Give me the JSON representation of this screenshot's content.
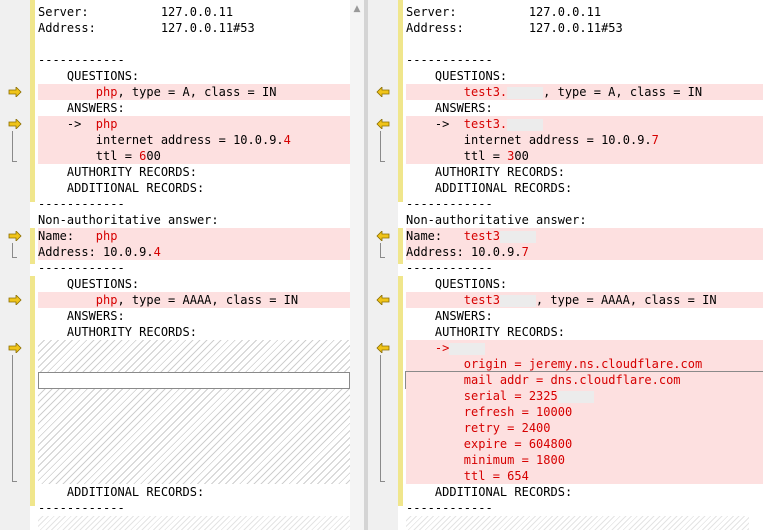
{
  "left": {
    "lines": [
      {
        "t": "Server:          127.0.0.11"
      },
      {
        "t": "Address:         127.0.0.11#53"
      },
      {
        "t": ""
      },
      {
        "t": "------------"
      },
      {
        "t": "    QUESTIONS:"
      },
      {
        "t": "",
        "diff": true,
        "pre": "        ",
        "red": "php",
        "post": ", type = A, class = IN"
      },
      {
        "t": "    ANSWERS:"
      },
      {
        "t": "",
        "diff": true,
        "pre": "    ->  ",
        "red": "php",
        "post": ""
      },
      {
        "t": "",
        "diff": true,
        "pre": "        internet address = 10.0.9.",
        "red": "4",
        "post": ""
      },
      {
        "t": "",
        "diff": true,
        "pre": "        ttl = ",
        "red": "6",
        "post": "00"
      },
      {
        "t": "    AUTHORITY RECORDS:"
      },
      {
        "t": "    ADDITIONAL RECORDS:"
      },
      {
        "t": "------------"
      },
      {
        "t": "Non-authoritative answer:"
      },
      {
        "t": "",
        "diff": true,
        "pre": "Name:   ",
        "red": "php",
        "post": ""
      },
      {
        "t": "",
        "diff": true,
        "pre": "Address: 10.0.9.",
        "red": "4",
        "post": ""
      },
      {
        "t": "------------"
      },
      {
        "t": "    QUESTIONS:"
      },
      {
        "t": "",
        "diff": true,
        "pre": "        ",
        "red": "php",
        "post": ", type = AAAA, class = IN"
      },
      {
        "t": "    ANSWERS:"
      },
      {
        "t": "    AUTHORITY RECORDS:"
      }
    ],
    "tail": [
      {
        "t": "    ADDITIONAL RECORDS:"
      },
      {
        "t": "------------"
      }
    ]
  },
  "right": {
    "lines": [
      {
        "t": "Server:          127.0.0.11"
      },
      {
        "t": "Address:         127.0.0.11#53"
      },
      {
        "t": ""
      },
      {
        "t": "------------"
      },
      {
        "t": "    QUESTIONS:"
      },
      {
        "t": "",
        "diff": true,
        "pre": "        ",
        "red": "test3.",
        "redact": true,
        "post": ", type = A, class = IN"
      },
      {
        "t": "    ANSWERS:"
      },
      {
        "t": "",
        "diff": true,
        "pre": "    ->  ",
        "red": "test3.",
        "redact": true,
        "post": ""
      },
      {
        "t": "",
        "diff": true,
        "pre": "        internet address = 10.0.9.",
        "red": "7",
        "post": ""
      },
      {
        "t": "",
        "diff": true,
        "pre": "        ttl = ",
        "red": "3",
        "post": "00"
      },
      {
        "t": "    AUTHORITY RECORDS:"
      },
      {
        "t": "    ADDITIONAL RECORDS:"
      },
      {
        "t": "------------"
      },
      {
        "t": "Non-authoritative answer:"
      },
      {
        "t": "",
        "diff": true,
        "pre": "Name:   ",
        "red": "test3",
        "redact": true,
        "post": ""
      },
      {
        "t": "",
        "diff": true,
        "pre": "Address: 10.0.9.",
        "red": "7",
        "post": ""
      },
      {
        "t": "------------"
      },
      {
        "t": "    QUESTIONS:"
      },
      {
        "t": "",
        "diff": true,
        "pre": "        ",
        "red": "test3",
        "redact": true,
        "post": ", type = AAAA, class = IN"
      },
      {
        "t": "    ANSWERS:"
      },
      {
        "t": "    AUTHORITY RECORDS:"
      },
      {
        "t": "",
        "diff": true,
        "pre": "    ",
        "red": "->",
        "redact": true,
        "post": ""
      },
      {
        "t": "",
        "diff": true,
        "pre": "        ",
        "red": "origin = jeremy.ns.cloudflare.com",
        "post": ""
      },
      {
        "t": "",
        "diff": true,
        "pre": "        ",
        "red": "mail addr = dns.cloudflare.com",
        "post": "",
        "boxed": true
      },
      {
        "t": "",
        "diff": true,
        "pre": "        ",
        "red": "serial = 2325",
        "redact": true,
        "post": ""
      },
      {
        "t": "",
        "diff": true,
        "pre": "        ",
        "red": "refresh = 10000",
        "post": ""
      },
      {
        "t": "",
        "diff": true,
        "pre": "        ",
        "red": "retry = 2400",
        "post": ""
      },
      {
        "t": "",
        "diff": true,
        "pre": "        ",
        "red": "expire = 604800",
        "post": ""
      },
      {
        "t": "",
        "diff": true,
        "pre": "        ",
        "red": "minimum = 1800",
        "post": ""
      },
      {
        "t": "",
        "diff": true,
        "pre": "        ",
        "red": "ttl = 654",
        "post": ""
      },
      {
        "t": "    ADDITIONAL RECORDS:"
      },
      {
        "t": "------------"
      }
    ]
  },
  "icons": {
    "diff_arrow_left": "arrow-right-icon",
    "diff_arrow_right": "arrow-left-icon"
  },
  "colors": {
    "diff_bg": "#fde0e0",
    "diff_text": "#d60000",
    "change_bar": "#f0e68c",
    "arrow": "#f0c419"
  }
}
